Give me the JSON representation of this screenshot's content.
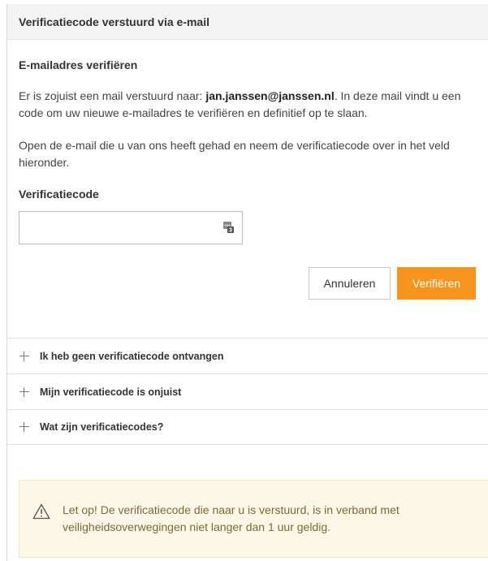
{
  "panel": {
    "title": "Verificatiecode verstuurd via e-mail"
  },
  "section": {
    "title": "E-mailadres verifiëren",
    "para1_before": "Er is zojuist een mail verstuurd naar: ",
    "para1_email": "jan.janssen@janssen.nl",
    "para1_after": ". In deze mail vindt u een code om uw nieuwe e-mailadres te verifiëren en definitief op te slaan.",
    "para2": "Open de e-mail die u van ons heeft gehad en neem de verificatiecode over in het veld hieronder."
  },
  "form": {
    "code_label": "Verificatiecode",
    "code_value": "",
    "cancel_label": "Annuleren",
    "verify_label": "Verifiëren"
  },
  "faq": {
    "items": [
      {
        "label": "Ik heb geen verificatiecode ontvangen",
        "icon": "plus-icon"
      },
      {
        "label": "Mijn verificatiecode is onjuist",
        "icon": "plus-icon"
      },
      {
        "label": "Wat zijn verificatiecodes?",
        "icon": "plus-icon"
      }
    ]
  },
  "warning": {
    "icon": "warning-icon",
    "text": "Let op! De verificatiecode die naar u is verstuurd, is in verband met veiligheidsoverwegingen niet langer dan 1 uur geldig."
  },
  "colors": {
    "accent": "#f7941d",
    "warning_bg": "#fcf7e7"
  }
}
